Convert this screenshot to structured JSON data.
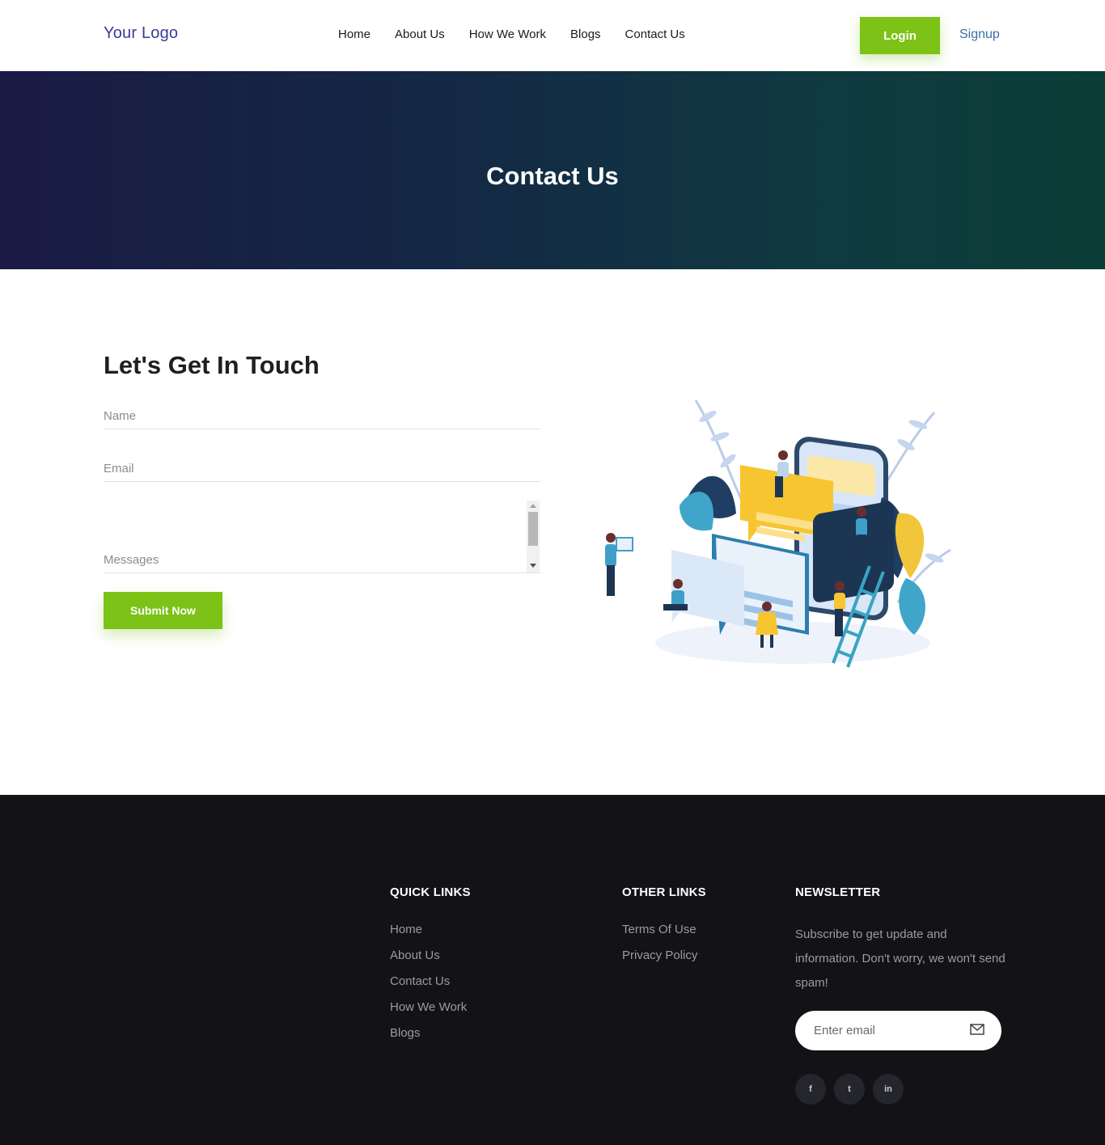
{
  "header": {
    "logo": "Your Logo",
    "nav": [
      "Home",
      "About Us",
      "How We Work",
      "Blogs",
      "Contact Us"
    ],
    "login_label": "Login",
    "signup_label": "Signup"
  },
  "banner": {
    "title": "Contact Us"
  },
  "contact": {
    "title": "Let's Get In Touch",
    "name_placeholder": "Name",
    "email_placeholder": "Email",
    "message_placeholder": "Messages",
    "submit_label": "Submit Now"
  },
  "footer": {
    "quick_links": {
      "title": "QUICK LINKS",
      "items": [
        "Home",
        "About Us",
        "Contact Us",
        "How We Work",
        "Blogs"
      ]
    },
    "other_links": {
      "title": "OTHER LINKS",
      "items": [
        "Terms Of Use",
        "Privacy Policy"
      ]
    },
    "newsletter": {
      "title": "NEWSLETTER",
      "text": "Subscribe to get update and information. Don't worry, we won't send spam!",
      "email_placeholder": "Enter email"
    },
    "social": {
      "icons": [
        "facebook-icon",
        "twitter-icon",
        "linkedin-icon"
      ],
      "glyphs": [
        "f",
        "t",
        "in"
      ]
    }
  },
  "colors": {
    "accent": "#7cc217",
    "banner_start": "#1a1a44",
    "banner_end": "#0b3d37",
    "footer_bg": "#121217",
    "logo": "#3a3a9e"
  }
}
